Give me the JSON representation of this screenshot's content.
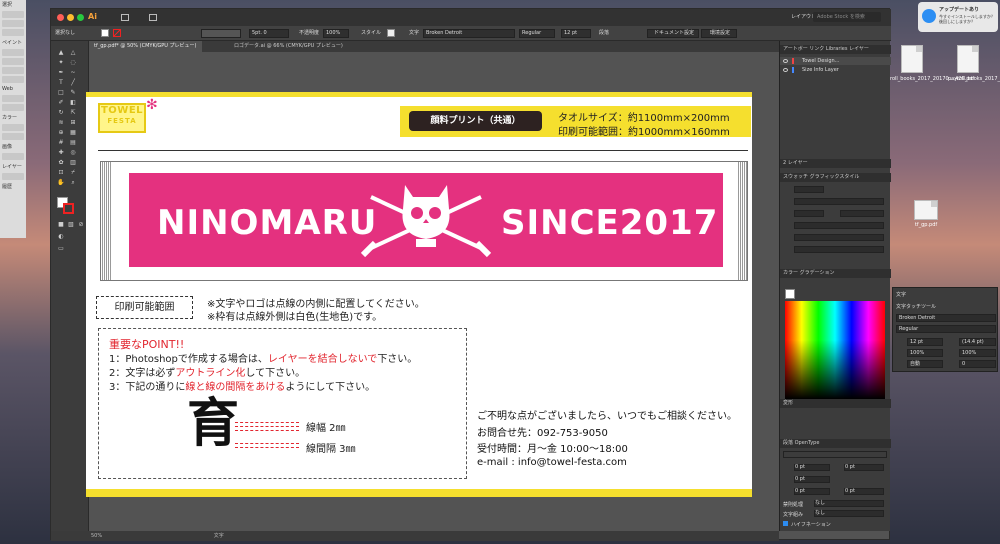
{
  "left_panel": {
    "title": "選択",
    "labels": [
      "ペイント",
      "Web",
      "カラー",
      "画像",
      "レイヤー",
      "履歴"
    ]
  },
  "app": {
    "app_icon": "Ai",
    "workspace": "レイアウト",
    "search_placeholder": "Adobe Stock を検索"
  },
  "control_bar": {
    "selection": "選択なし",
    "stroke_size": "5pt. 0",
    "opacity_label": "不透明度",
    "opacity_value": "100%",
    "style_label": "スタイル",
    "char_label": "文字",
    "font_name": "Broken Detroit",
    "font_style": "Regular",
    "font_size": "12 pt",
    "paragraph_label": "段落",
    "doc_setup": "ドキュメント設定",
    "preferences": "環境設定"
  },
  "tabs": [
    {
      "label": "tf_gp.pdf* @ 50% (CMYK/GPU プレビュー)"
    },
    {
      "label": "ロゴデータ.ai @ 66% (CMYK/GPU プレビュー)"
    }
  ],
  "status": {
    "zoom": "50%",
    "tool": "文字"
  },
  "artboard": {
    "logo_line1": "TOWEL",
    "logo_line2": "FESTA",
    "info_button": "顔料プリント（共通）",
    "towel_size": "タオルサイズ：約1100mm×200mm",
    "print_range": "印刷可能範囲：約1000mm×160mm",
    "banner_left": "NINOMARU",
    "banner_right": "SINCE2017",
    "print_area_label": "印刷可能範囲",
    "note1": "※文字やロゴは点線の内側に配置してください。",
    "note2": "※枠有は点線外側は白色(生地色)です。",
    "point_title": "重要なPOINT!!",
    "point1_a": "1：Photoshopで作成する場合は、",
    "point1_red": "レイヤーを結合しないで",
    "point1_b": "下さい。",
    "point2_a": "2：文字は必ず",
    "point2_red": "アウトライン化",
    "point2_b": "して下さい。",
    "point3_a": "3：下記の通りに",
    "point3_red": "線と線の間隔をあける",
    "point3_b": "ようにして下さい。",
    "kanji": "育",
    "line_width": "線幅 2㎜",
    "line_gap": "線間隔 3㎜",
    "contact_intro": "ご不明な点がございましたら、いつでもご相談ください。",
    "contact_phone": "お問合せ先：092-753-9050",
    "contact_hours": "受付時間：月〜金 10:00〜18:00",
    "contact_email": "e-mail : info@towel-festa.com"
  },
  "right_panel": {
    "top_tabs": "アートボー リンク Libraries レイヤー",
    "layers": [
      "Towel Design...",
      "Size Info Layer"
    ],
    "layer_count": "2 レイヤー",
    "swatch_tabs": "スウォッチ グラフィックスタイル",
    "color_tabs": "カラー グラデーション",
    "transform": "変形",
    "paragraph_tabs": "段落 OpenType",
    "pt0": "0 pt",
    "kinsoku": "禁則処理",
    "kumi": "文字組み",
    "none": "なし",
    "hyphen": "ハイフネーション"
  },
  "desktop": {
    "notif_title": "アップデートあり",
    "notif_body": "今すぐインストールしますか？後回しにしますか？",
    "files": [
      {
        "label": "roll_books_2017_20170....426.pdf"
      },
      {
        "label": "payroll_books_2017_20170....2306.pdf"
      },
      {
        "label": "tf_gp.pdf"
      }
    ]
  },
  "char_panel": {
    "title": "文字",
    "touch_tool": "文字タッチツール",
    "font": "Broken Detroit",
    "style": "Regular",
    "size": "12 pt",
    "leading": "(14.4 pt)",
    "hscale": "100%",
    "vscale": "100%",
    "kerning": "自動",
    "tracking": "0"
  }
}
